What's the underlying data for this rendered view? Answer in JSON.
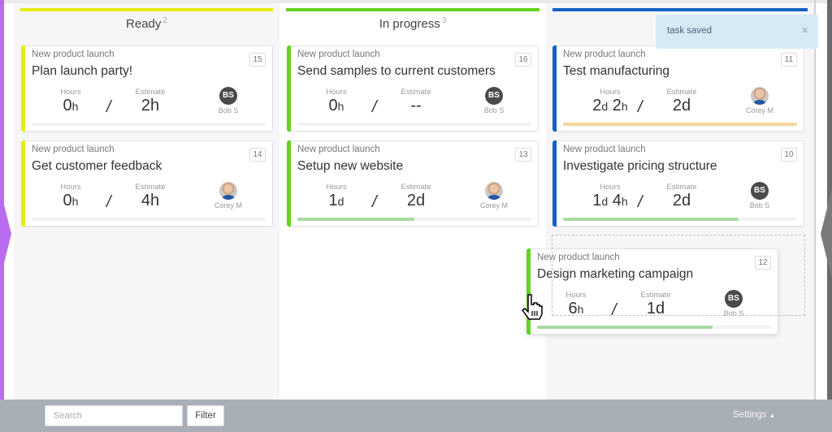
{
  "board": {
    "columns": [
      {
        "title": "Ready",
        "count": "2",
        "color": "#e6ed0e",
        "cards": [
          {
            "project": "New product launch",
            "title": "Plan launch party!",
            "number": "15",
            "hours_label": "Hours",
            "hours_main": "0",
            "hours_unit": "h",
            "hours_main2": "",
            "hours_unit2": "",
            "estimate_label": "Estimate",
            "estimate": "2h",
            "assignee_initials": "BS",
            "assignee": "Bob S",
            "avatar_type": "initials",
            "progress": 0,
            "progress_color": "#a8dba0"
          },
          {
            "project": "New product launch",
            "title": "Get customer feedback",
            "number": "14",
            "hours_label": "Hours",
            "hours_main": "0",
            "hours_unit": "h",
            "hours_main2": "",
            "hours_unit2": "",
            "estimate_label": "Estimate",
            "estimate": "4h",
            "assignee_initials": "CM",
            "assignee": "Corey M",
            "avatar_type": "photo",
            "progress": 0,
            "progress_color": "#a8dba0"
          }
        ]
      },
      {
        "title": "In progress",
        "count": "3",
        "color": "#62d420",
        "cards": [
          {
            "project": "New product launch",
            "title": "Send samples to current customers",
            "number": "16",
            "hours_label": "Hours",
            "hours_main": "0",
            "hours_unit": "h",
            "hours_main2": "",
            "hours_unit2": "",
            "estimate_label": "Estimate",
            "estimate": "--",
            "assignee_initials": "BS",
            "assignee": "Bob S",
            "avatar_type": "initials",
            "progress": 0,
            "progress_color": "#a8dba0"
          },
          {
            "project": "New product launch",
            "title": "Setup new website",
            "number": "13",
            "hours_label": "Hours",
            "hours_main": "1",
            "hours_unit": "d",
            "hours_main2": "",
            "hours_unit2": "",
            "estimate_label": "Estimate",
            "estimate": "2d",
            "assignee_initials": "CM",
            "assignee": "Corey M",
            "avatar_type": "photo",
            "progress": 50,
            "progress_color": "#a8dba0"
          }
        ]
      },
      {
        "title": "",
        "count": "",
        "color": "#1560c2",
        "cards": [
          {
            "project": "New product launch",
            "title": "Test manufacturing",
            "number": "11",
            "hours_label": "Hours",
            "hours_main": "2",
            "hours_unit": "d",
            "hours_main2": "2",
            "hours_unit2": "h",
            "estimate_label": "Estimate",
            "estimate": "2d",
            "assignee_initials": "CM",
            "assignee": "Corey M",
            "avatar_type": "photo",
            "progress": 100,
            "progress_color": "#f7d59c"
          },
          {
            "project": "New product launch",
            "title": "Investigate pricing structure",
            "number": "10",
            "hours_label": "Hours",
            "hours_main": "1",
            "hours_unit": "d",
            "hours_main2": "4",
            "hours_unit2": "h",
            "estimate_label": "Estimate",
            "estimate": "2d",
            "assignee_initials": "BS",
            "assignee": "Bob S",
            "avatar_type": "initials",
            "progress": 75,
            "progress_color": "#a8dba0"
          }
        ]
      }
    ],
    "dragging_card": {
      "project": "New product launch",
      "title": "Design marketing campaign",
      "number": "12",
      "hours_label": "Hours",
      "hours_main": "6",
      "hours_unit": "h",
      "hours_main2": "",
      "hours_unit2": "",
      "estimate_label": "Estimate",
      "estimate": "1d",
      "assignee_initials": "BS",
      "assignee": "Bob S",
      "avatar_type": "initials",
      "progress": 75,
      "progress_color": "#a8dba0",
      "stripe_color": "#62d420"
    }
  },
  "toast": {
    "message": "task saved",
    "close_icon": "×"
  },
  "footer": {
    "search_placeholder": "Search",
    "search_value": "",
    "filter_label": "Filter",
    "settings_label": "Settings",
    "settings_caret": "▲"
  },
  "slash": "/"
}
